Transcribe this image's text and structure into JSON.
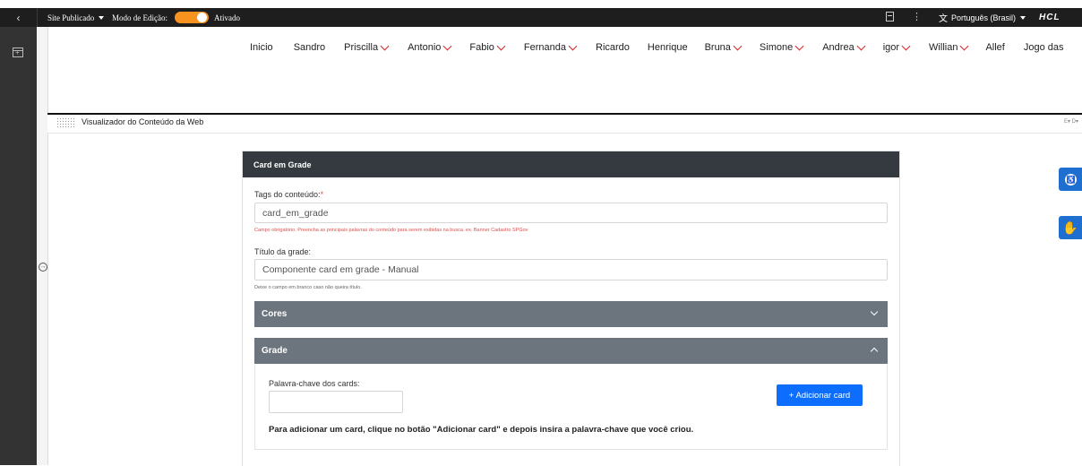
{
  "topbar": {
    "back_icon": "chevron-left-icon",
    "site_label": "Site Publicado",
    "edit_mode_label": "Modo de Edição:",
    "edit_mode_state": "Ativado",
    "language": "Português (Brasil)",
    "logo": "HCL",
    "accent_color": "#f7931e"
  },
  "nav": {
    "items": [
      {
        "label": "Inicio",
        "dropdown": false
      },
      {
        "label": "Sandro",
        "dropdown": false
      },
      {
        "label": "Priscilla",
        "dropdown": true
      },
      {
        "label": "Antonio",
        "dropdown": true
      },
      {
        "label": "Fabio",
        "dropdown": true
      },
      {
        "label": "Fernanda",
        "dropdown": true
      },
      {
        "label": "Ricardo",
        "dropdown": false
      },
      {
        "label": "Henrique",
        "dropdown": false
      },
      {
        "label": "Bruna",
        "dropdown": true
      },
      {
        "label": "Simone",
        "dropdown": true
      },
      {
        "label": "Andrea",
        "dropdown": true
      },
      {
        "label": "igor",
        "dropdown": true
      },
      {
        "label": "Willian",
        "dropdown": true
      },
      {
        "label": "Allef",
        "dropdown": false
      },
      {
        "label": "Jogo das",
        "dropdown": false
      }
    ],
    "chevron_color": "#d9242b"
  },
  "viewer": {
    "title": "Visualizador do Conteúdo da Web",
    "actions": "E▾ D▾"
  },
  "form": {
    "header": "Card em Grade",
    "tags_label": "Tags do conteúdo:",
    "tags_required": "*",
    "tags_value": "card_em_grade",
    "tags_help": "Campo obrigatório. Preencha as principais palavras do conteúdo para serem exibidas na busca. ex. Banner Cadastro SPGov",
    "title_label": "Título da grade:",
    "title_value": "Componente card em grade - Manual",
    "title_help": "Deixe o campo em branco caso não queira título.",
    "section_cores": "Cores",
    "section_grade": "Grade",
    "keyword_label": "Palavra-chave dos cards:",
    "keyword_value": "",
    "add_button": "+ Adicionar card",
    "instructions": "Para adicionar um card, clique no botão \"Adicionar card\" e depois insira a palavra-chave que você criou.",
    "header_color": "#343a40",
    "section_color": "#6c757d",
    "button_color": "#0d6efd",
    "help_error_color": "#d9534f"
  },
  "side_buttons": {
    "accessibility_icon": "accessibility-icon",
    "sign_language_icon": "sign-language-hand-icon"
  }
}
